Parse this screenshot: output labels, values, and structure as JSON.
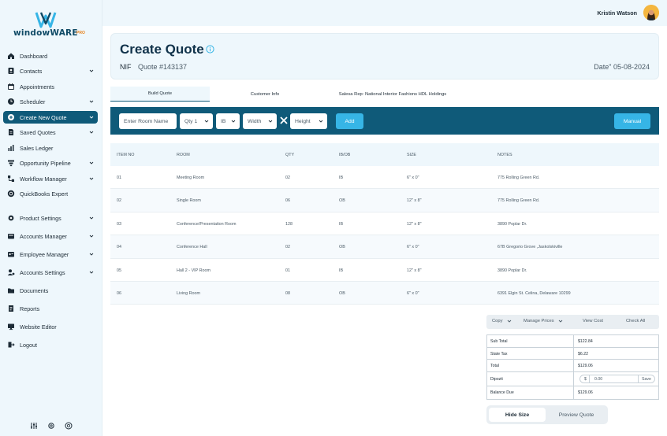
{
  "brand": {
    "logo_text": "windowWARE",
    "logo_suffix": "PRO",
    "primary": "#0f5a79",
    "accent": "#36b5e6",
    "logo_orange": "#e8821e"
  },
  "sidebar": {
    "items": [
      {
        "label": "Dashboard",
        "icon": "home-icon",
        "chevron": false
      },
      {
        "label": "Contacts",
        "icon": "contacts-icon",
        "chevron": true
      },
      {
        "label": "Appointments",
        "icon": "calendar-icon",
        "chevron": false
      },
      {
        "label": "Scheduler",
        "icon": "clock-icon",
        "chevron": true
      },
      {
        "label": "Create New Quote",
        "icon": "plus-circle-icon",
        "chevron": true,
        "active": true
      },
      {
        "label": "Saved Quotes",
        "icon": "document-icon",
        "chevron": true
      },
      {
        "label": "Sales Ledger",
        "icon": "bar-chart-icon",
        "chevron": false
      },
      {
        "label": "Opportunity Pipeline",
        "icon": "pipeline-icon",
        "chevron": true
      },
      {
        "label": "Workflow Manager",
        "icon": "workflow-icon",
        "chevron": true
      },
      {
        "label": "QuickBooks Expert",
        "icon": "quickbooks-icon",
        "chevron": false
      },
      {
        "label": "Product Settings",
        "icon": "gear-icon",
        "chevron": true
      },
      {
        "label": "Accounts Manager",
        "icon": "accounts-icon",
        "chevron": true
      },
      {
        "label": "Employee Manager",
        "icon": "employee-icon",
        "chevron": true
      },
      {
        "label": "Accounts Settings",
        "icon": "user-settings-icon",
        "chevron": true
      },
      {
        "label": "Documents",
        "icon": "folder-icon",
        "chevron": false
      },
      {
        "label": "Reports",
        "icon": "report-icon",
        "chevron": false
      },
      {
        "label": "Website Editor",
        "icon": "monitor-icon",
        "chevron": false
      },
      {
        "label": "Logout",
        "icon": "logout-icon",
        "chevron": false
      }
    ]
  },
  "topbar": {
    "user_name": "Kristin Watson"
  },
  "header": {
    "title": "Create Quote",
    "nif": "NIF",
    "quote_number": "Quote #143137",
    "date": "Date\" 05-08-2024"
  },
  "tabs": [
    {
      "label": "Build Quote",
      "active": true
    },
    {
      "label": "Customer Info",
      "active": false
    },
    {
      "label": "Salesa Rep: National Interior Fashions HDL Holdings",
      "active": false
    }
  ],
  "toolbar": {
    "room_placeholder": "Enter Room Name",
    "qty_value": "Qty 1",
    "ib_value": "IB",
    "width_value": "Width",
    "height_value": "Height",
    "add_label": "Add",
    "manual_label": "Manual"
  },
  "table": {
    "columns": [
      "ITEM NO",
      "ROOM",
      "QTY",
      "IB/OB",
      "SIZE",
      "NOTES"
    ],
    "rows": [
      [
        "01",
        "Meeting Room",
        "02",
        "IB",
        "6\" x 0\"",
        "775 Rolling Green Rd."
      ],
      [
        "02",
        "Single Room",
        "06",
        "OB",
        "12\" x 8\"",
        "775 Rolling Green Rd."
      ],
      [
        "03",
        "Conference/Presentation Room",
        "128",
        "IB",
        "12\" x 8\"",
        "3890 Poplar Dr."
      ],
      [
        "04",
        "Conference Hall",
        "02",
        "OB",
        "6\" x 0\"",
        "67B Gregorio Grove ,Jaskolskiville"
      ],
      [
        "05",
        "Hall 2 - VIP Room",
        "01",
        "IB",
        "12\" x 8\"",
        "3890 Poplar Dr."
      ],
      [
        "06",
        "Living Room",
        "08",
        "OB",
        "6\" x 0\"",
        "6391 Elgin St. Celina, Delaware 10299"
      ]
    ]
  },
  "actions": {
    "copy": "Copy",
    "manage_prices": "Manage Prices",
    "view_cost": "View Cost",
    "check_all": "Check All"
  },
  "totals": {
    "subtotal_label": "Sub Total",
    "subtotal": "$122.84",
    "tax_label": "State Tax",
    "tax": "$6.22",
    "total_label": "Total",
    "total": "$129.06",
    "deposit_label": "Dipozit",
    "deposit_currency": "$",
    "deposit_value": "0.00",
    "deposit_save": "Save",
    "balance_label": "Balance Due",
    "balance": "$129.06"
  },
  "toggle": {
    "hide_size": "Hide Size",
    "preview_quote": "Preview Quote"
  }
}
